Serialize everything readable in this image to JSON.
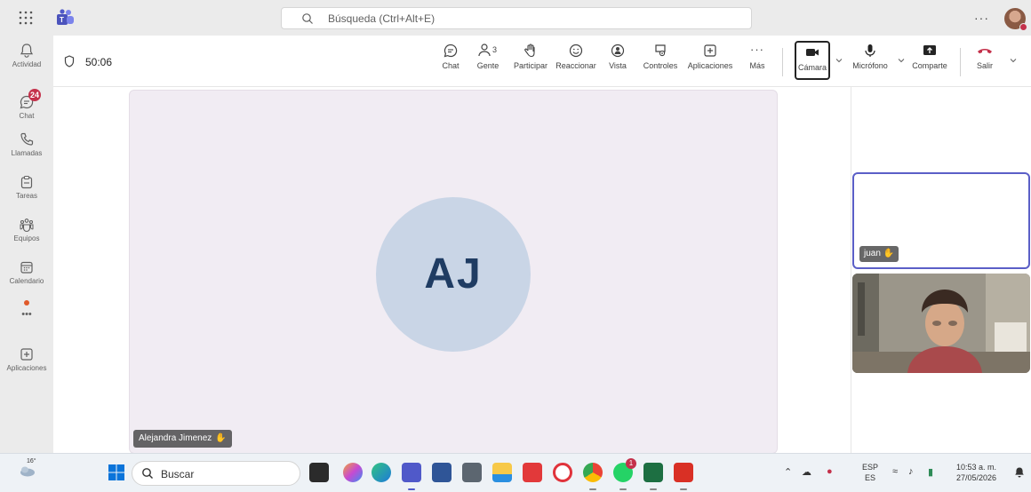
{
  "top_bar": {
    "search_placeholder": "Búsqueda (Ctrl+Alt+E)",
    "more_label": "···"
  },
  "rail": {
    "items": [
      {
        "label": "Actividad",
        "icon": "bell-icon"
      },
      {
        "label": "Chat",
        "icon": "chat-icon",
        "badge": "24"
      },
      {
        "label": "Llamadas",
        "icon": "phone-icon"
      },
      {
        "label": "Tareas",
        "icon": "tasks-icon"
      },
      {
        "label": "Equipos",
        "icon": "teams-icon"
      },
      {
        "label": "Calendario",
        "icon": "calendar-icon"
      },
      {
        "label": "•••",
        "icon": "more-icon"
      },
      {
        "label": "Aplicaciones",
        "icon": "apps-add-icon"
      }
    ]
  },
  "meeting": {
    "timer": "50:06",
    "toolbar": {
      "chat": "Chat",
      "people": "Gente",
      "people_count": "3",
      "raise_hand": "Participar",
      "react": "Reaccionar",
      "view": "Vista",
      "controls": "Controles",
      "apps": "Aplicaciones",
      "more": "Más",
      "more_dots": "···",
      "camera": "Cámara",
      "mic": "Micrófono",
      "share": "Comparte",
      "leave": "Salir"
    }
  },
  "stage": {
    "main_participant": {
      "initials": "AJ",
      "name": "Alejandra Jimenez"
    },
    "side_participants": [
      {
        "name": "juan"
      }
    ]
  },
  "taskbar": {
    "temperature": "16°",
    "search_label": "Buscar",
    "lang_top": "ESP",
    "lang_bottom": "ES",
    "time": "10:53 a. m.",
    "date": "27/05/2026",
    "chrome_badge": "1"
  },
  "colors": {
    "accent": "#5b5fc7",
    "badge": "#c4314b",
    "avatar_bg": "#c9d5e6",
    "avatar_text": "#1f3c63",
    "leave_red": "#c4314b"
  }
}
